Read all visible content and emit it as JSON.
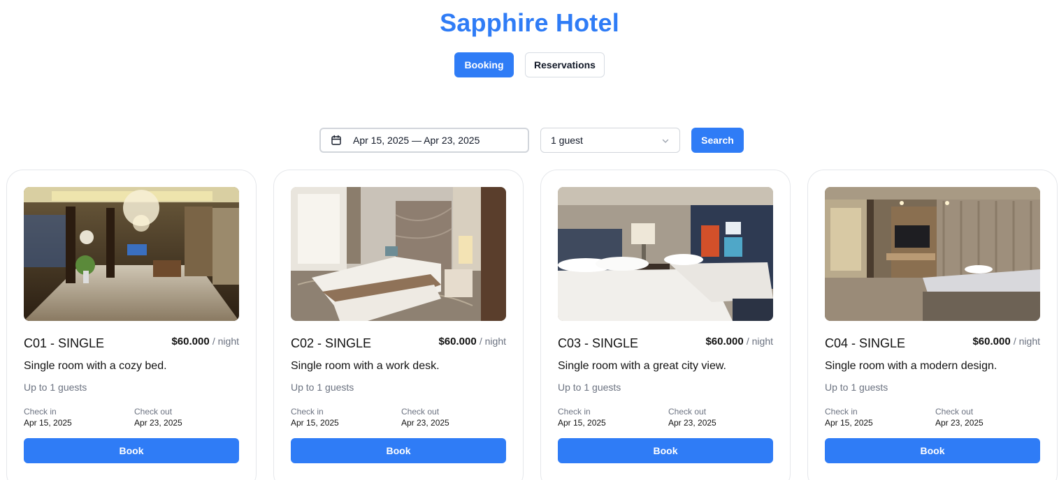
{
  "app": {
    "title": "Sapphire Hotel"
  },
  "tabs": [
    {
      "label": "Booking",
      "active": true
    },
    {
      "label": "Reservations",
      "active": false
    }
  ],
  "search": {
    "date_range": "Apr 15, 2025 — Apr 23, 2025",
    "guests": "1 guest",
    "button": "Search"
  },
  "colors": {
    "accent": "#2f7cf6"
  },
  "rooms": [
    {
      "name": "C01 - SINGLE",
      "price": "$60.000",
      "unit": "/ night",
      "description": "Single room with a cozy bed.",
      "capacity": "Up to 1 guests",
      "checkin_label": "Check in",
      "checkin": "Apr 15, 2025",
      "checkout_label": "Check out",
      "checkout": "Apr 23, 2025",
      "book": "Book"
    },
    {
      "name": "C02 - SINGLE",
      "price": "$60.000",
      "unit": "/ night",
      "description": "Single room with a work desk.",
      "capacity": "Up to 1 guests",
      "checkin_label": "Check in",
      "checkin": "Apr 15, 2025",
      "checkout_label": "Check out",
      "checkout": "Apr 23, 2025",
      "book": "Book"
    },
    {
      "name": "C03 - SINGLE",
      "price": "$60.000",
      "unit": "/ night",
      "description": "Single room with a great city view.",
      "capacity": "Up to 1 guests",
      "checkin_label": "Check in",
      "checkin": "Apr 15, 2025",
      "checkout_label": "Check out",
      "checkout": "Apr 23, 2025",
      "book": "Book"
    },
    {
      "name": "C04 - SINGLE",
      "price": "$60.000",
      "unit": "/ night",
      "description": "Single room with a modern design.",
      "capacity": "Up to 1 guests",
      "checkin_label": "Check in",
      "checkin": "Apr 15, 2025",
      "checkout_label": "Check out",
      "checkout": "Apr 23, 2025",
      "book": "Book"
    }
  ]
}
